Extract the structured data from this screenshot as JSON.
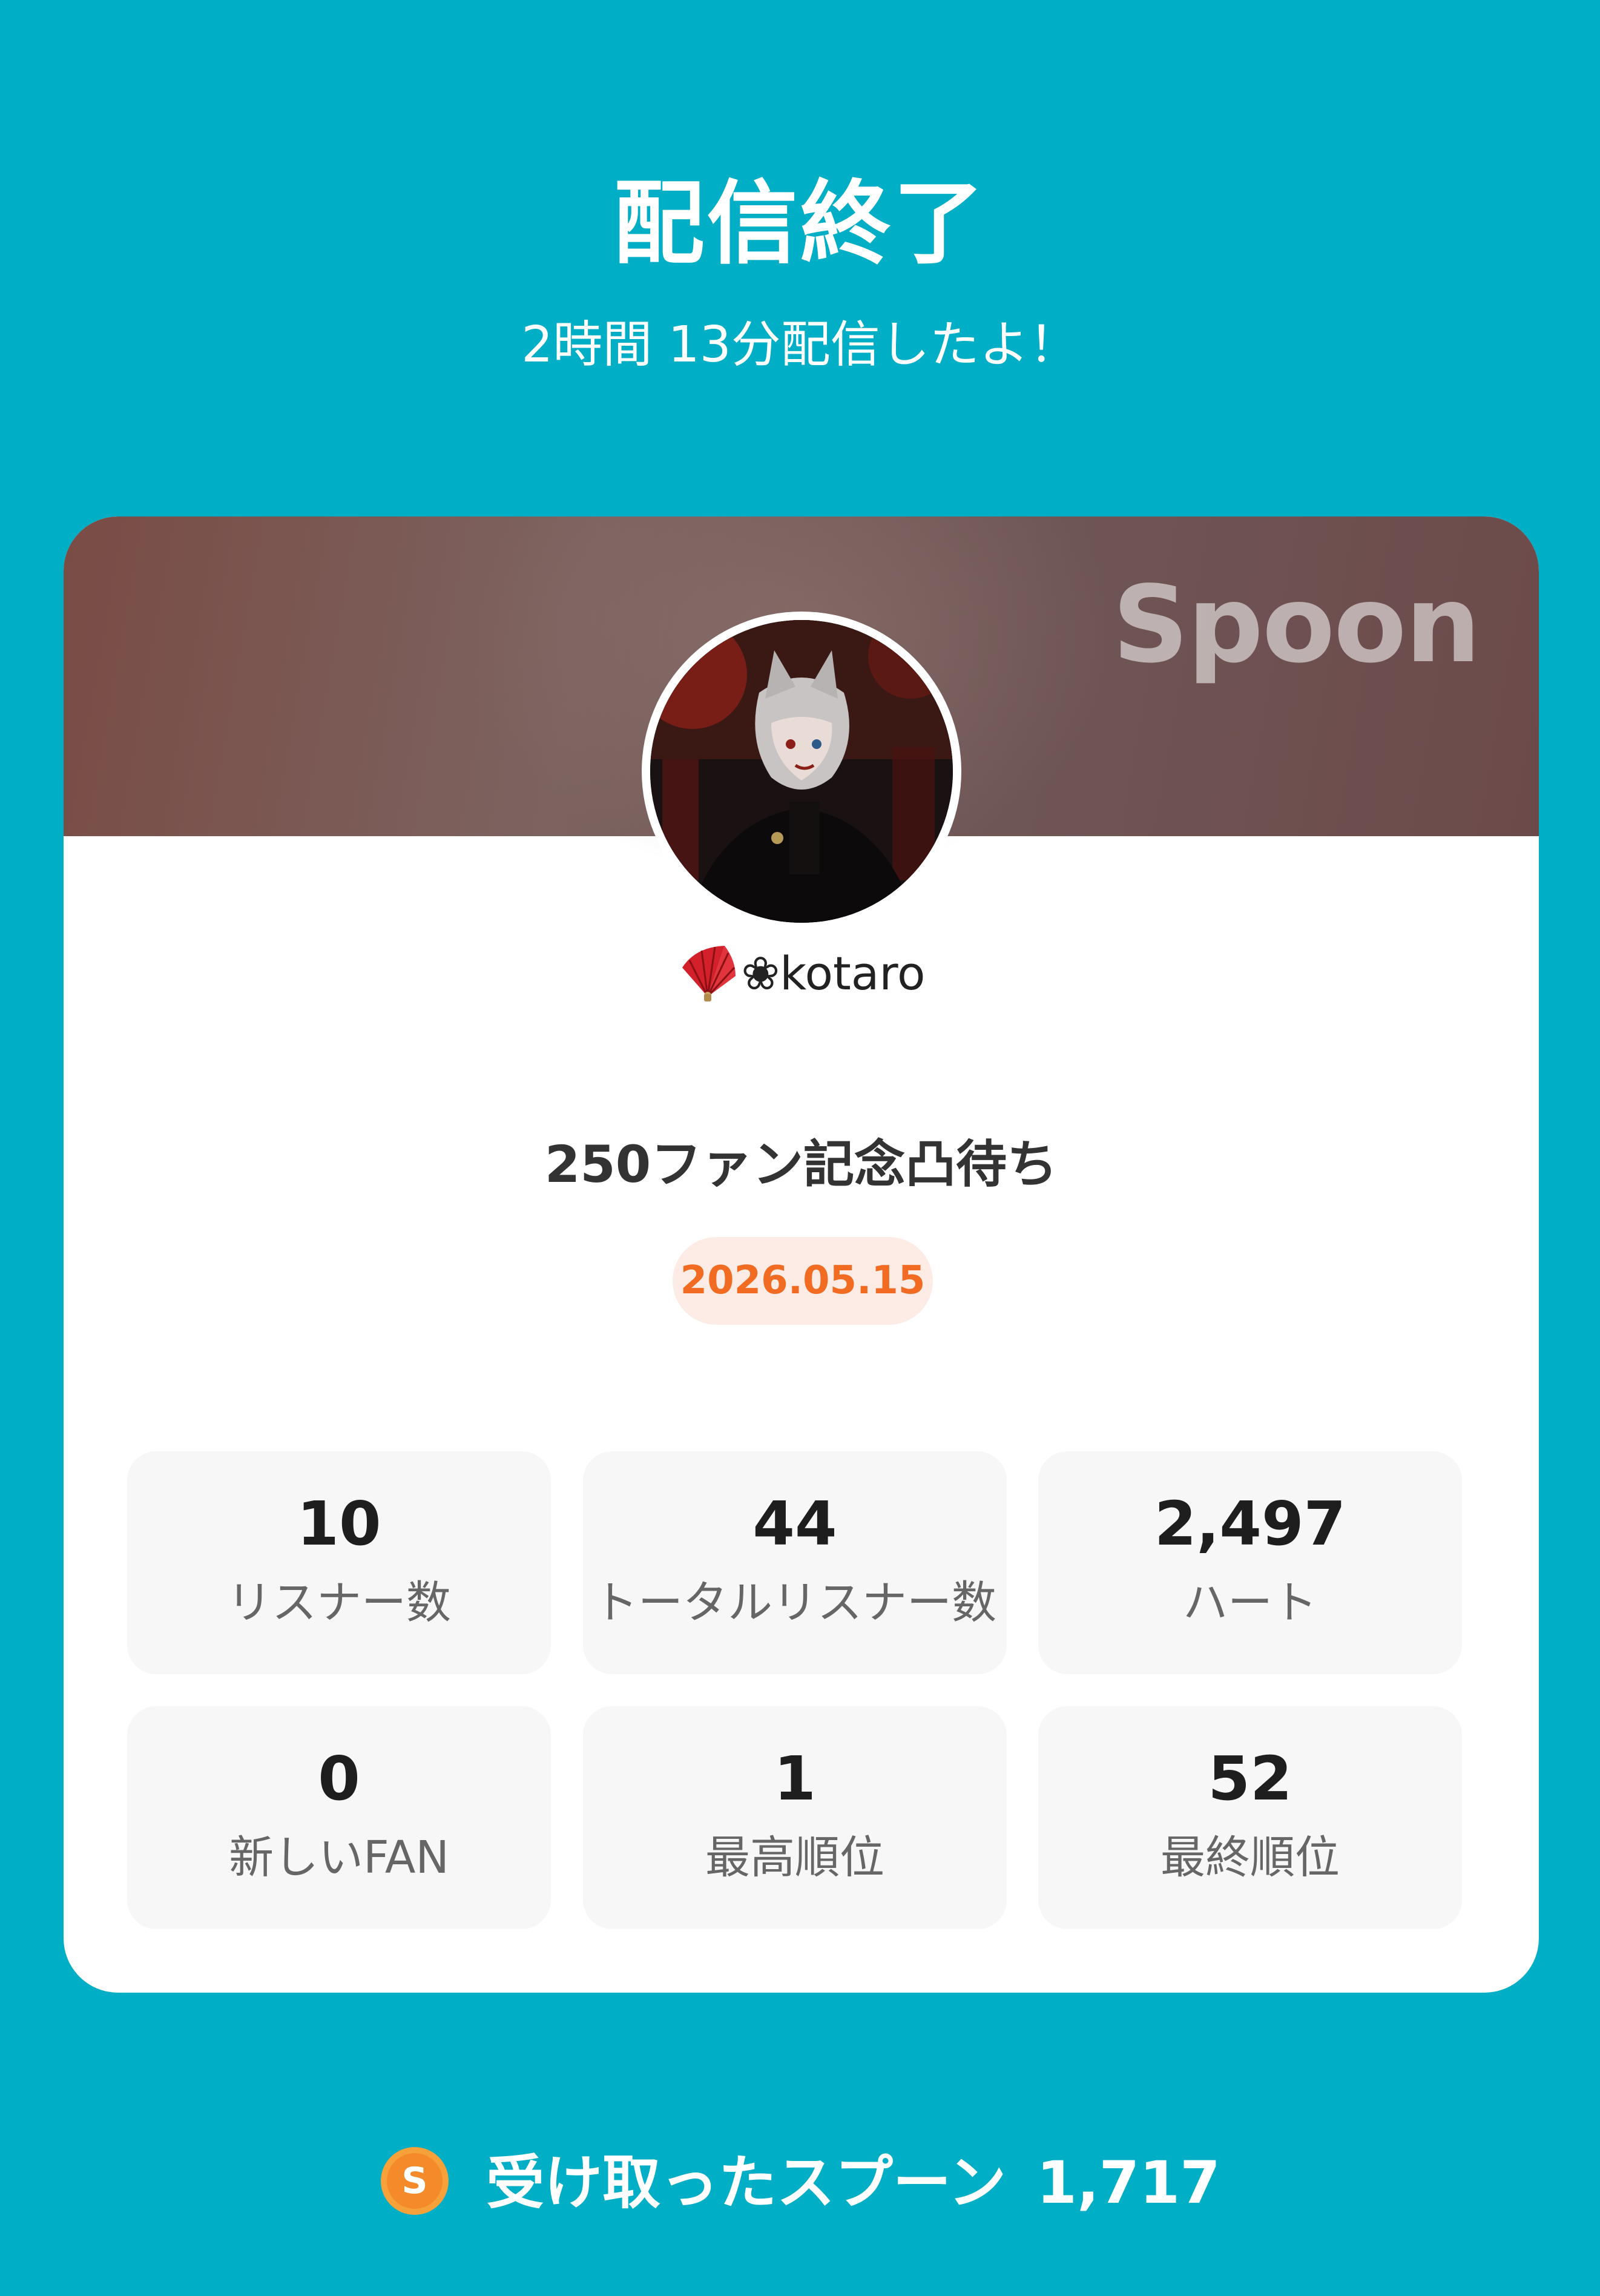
{
  "header": {
    "title": "配信終了",
    "subtitle": "2時間 13分配信したよ！"
  },
  "card": {
    "brand": "Spoon",
    "username": "❀kotaro",
    "stream_title": "250ファン記念凸待ち",
    "date": "2026.05.15"
  },
  "stats": [
    {
      "value": "10",
      "label": "リスナー数"
    },
    {
      "value": "44",
      "label": "トータルリスナー数"
    },
    {
      "value": "2,497",
      "label": "ハート"
    },
    {
      "value": "0",
      "label": "新しいFAN"
    },
    {
      "value": "1",
      "label": "最高順位"
    },
    {
      "value": "52",
      "label": "最終順位"
    }
  ],
  "footer": {
    "spoons_label": "受け取ったスプーン",
    "spoons_value": "1,717"
  },
  "colors": {
    "background": "#00aec6",
    "accent_date": "#f26b22",
    "banner": "#7c6360"
  },
  "icons": {
    "user_badge": "folding-fan-icon",
    "spoon": "spoon-coin-icon"
  }
}
